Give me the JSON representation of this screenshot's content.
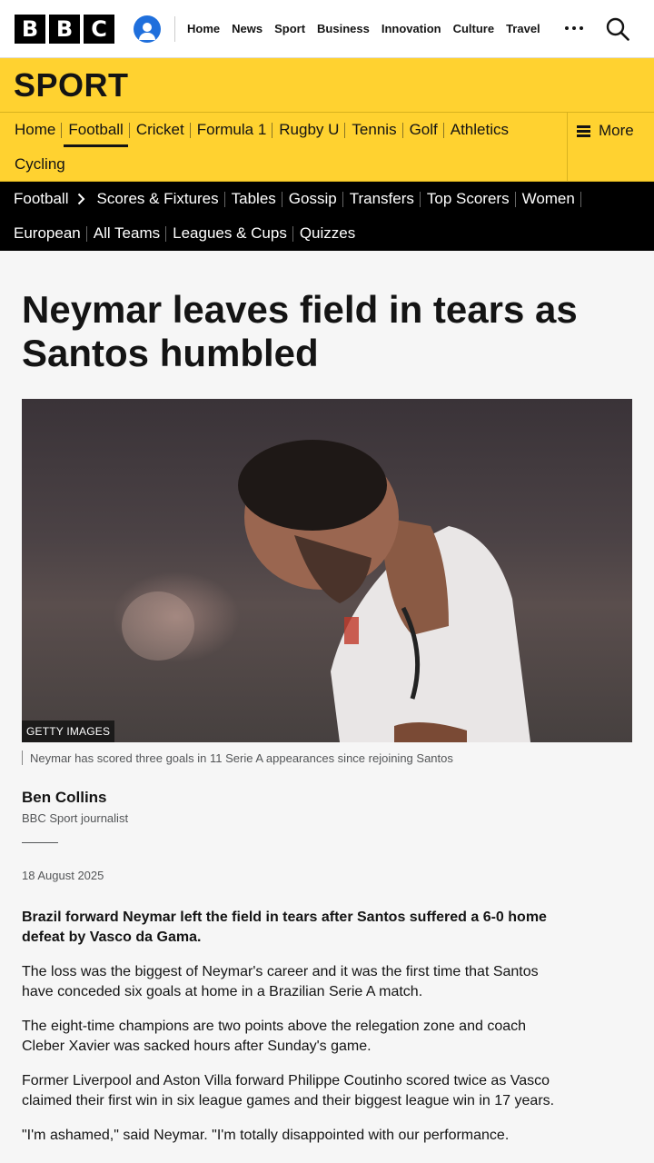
{
  "brand": {
    "letters": [
      "B",
      "B",
      "C"
    ]
  },
  "topnav": [
    "Home",
    "News",
    "Sport",
    "Business",
    "Innovation",
    "Culture",
    "Travel"
  ],
  "sport_title": "SPORT",
  "sport_nav": {
    "items": [
      "Home",
      "Football",
      "Cricket",
      "Formula 1",
      "Rugby U",
      "Tennis",
      "Golf",
      "Athletics",
      "Cycling"
    ],
    "active": "Football",
    "more_label": "More"
  },
  "football_nav": {
    "items": [
      "Football",
      "Scores & Fixtures",
      "Tables",
      "Gossip",
      "Transfers",
      "Top Scorers",
      "Women",
      "European",
      "All Teams",
      "Leagues & Cups",
      "Quizzes"
    ]
  },
  "article": {
    "headline": "Neymar leaves field in tears as Santos humbled",
    "image_credit": "GETTY IMAGES",
    "caption": "Neymar has scored three goals in 11 Serie A appearances since rejoining Santos",
    "author": "Ben Collins",
    "author_role": "BBC Sport journalist",
    "date": "18 August 2025",
    "paragraphs": [
      "Brazil forward Neymar left the field in tears after Santos suffered a 6-0 home defeat by Vasco da Gama.",
      "The loss was the biggest of Neymar's career and it was the first time that Santos have conceded six goals at home in a Brazilian Serie A match.",
      "The eight-time champions are two points above the relegation zone and coach Cleber Xavier was sacked hours after Sunday's game.",
      "Former Liverpool and Aston Villa forward Philippe Coutinho scored twice as Vasco claimed their first win in six league games and their biggest league win in 17 years.",
      "\"I'm ashamed,\" said Neymar. \"I'm totally disappointed with our performance."
    ]
  },
  "colors": {
    "sport_yellow": "#ffd230",
    "account_blue": "#1f6fdc"
  }
}
